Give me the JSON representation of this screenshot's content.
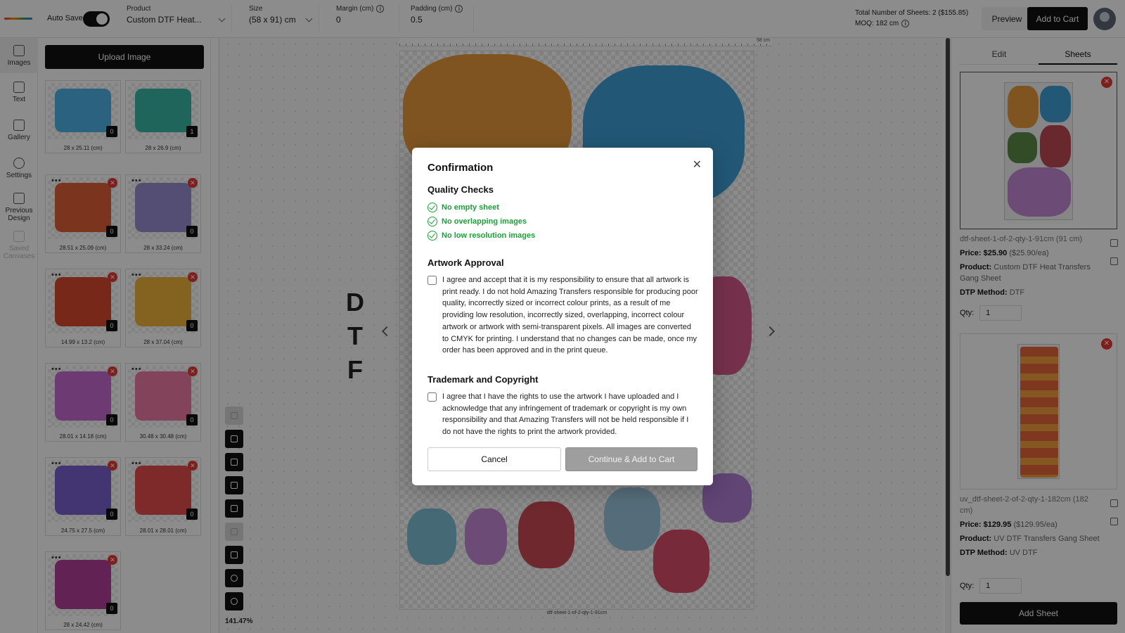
{
  "topbar": {
    "autosave_label": "Auto Save",
    "product_label": "Product",
    "product_value": "Custom DTF Heat...",
    "size_label": "Size",
    "size_value": "(58 x 91) cm",
    "margin_label": "Margin (cm)",
    "margin_value": "0",
    "padding_label": "Padding (cm)",
    "padding_value": "0.5",
    "total_sheets": "Total Number of Sheets: 2 ($155.85)",
    "moq": "MOQ: 182 cm",
    "preview_label": "Preview",
    "add_to_cart_label": "Add to Cart"
  },
  "rail": {
    "items": [
      {
        "label": "Images"
      },
      {
        "label": "Text"
      },
      {
        "label": "Gallery"
      },
      {
        "label": "Settings"
      },
      {
        "label": "Previous Design"
      },
      {
        "label": "Saved Canvases"
      }
    ]
  },
  "panel": {
    "upload_label": "Upload Image",
    "thumbs": [
      {
        "size": "28 x 25.11 (cm)",
        "count": "0",
        "color": "#4fb3e8"
      },
      {
        "size": "28 x 26.9 (cm)",
        "count": "1",
        "color": "#39b8a8"
      },
      {
        "size": "28.51 x 25.09 (cm)",
        "count": "0",
        "color": "#e0623a"
      },
      {
        "size": "28 x 33.24 (cm)",
        "count": "0",
        "color": "#9a8fd6"
      },
      {
        "size": "14.99 x 13.2 (cm)",
        "count": "0",
        "color": "#d9492f"
      },
      {
        "size": "28 x 37.04 (cm)",
        "count": "0",
        "color": "#f1b23b"
      },
      {
        "size": "28.01 x 14.18 (cm)",
        "count": "0",
        "color": "#c86bd3"
      },
      {
        "size": "30.48 x 30.48 (cm)",
        "count": "0",
        "color": "#ef7aa6"
      },
      {
        "size": "24.75 x 27.5 (cm)",
        "count": "0",
        "color": "#7b5fd0"
      },
      {
        "size": "28.01 x 28.01 (cm)",
        "count": "0",
        "color": "#e64d4d"
      },
      {
        "size": "28 x 24.42 (cm)",
        "count": "0",
        "color": "#b23f9a"
      }
    ]
  },
  "canvas": {
    "ruler_end": "58 cm",
    "dtf_letters": [
      "D",
      "T",
      "F"
    ],
    "sheet_caption": "dtf-sheet-1-of-2-qty-1-91cm",
    "zoom": "141.47%"
  },
  "right_panel": {
    "tab_edit": "Edit",
    "tab_sheets": "Sheets",
    "sheets": [
      {
        "name": "dtf-sheet-1-of-2-qty-1-91cm (91 cm)",
        "price_label": "Price:",
        "price": "$25.90",
        "price_each": "($25.90/ea)",
        "product_label": "Product:",
        "product": "Custom DTF Heat Transfers Gang Sheet",
        "method_label": "DTP Method:",
        "method": "DTF",
        "qty_label": "Qty:",
        "qty": "1"
      },
      {
        "name": "uv_dtf-sheet-2-of-2-qty-1-182cm (182 cm)",
        "price_label": "Price:",
        "price": "$129.95",
        "price_each": "($129.95/ea)",
        "product_label": "Product:",
        "product": "UV DTF Transfers Gang Sheet",
        "method_label": "DTP Method:",
        "method": "UV DTF",
        "qty_label": "Qty:",
        "qty": "1"
      }
    ],
    "add_sheet_label": "Add Sheet"
  },
  "modal": {
    "title": "Confirmation",
    "quality_title": "Quality Checks",
    "checks": [
      "No empty sheet",
      "No overlapping images",
      "No low resolution images"
    ],
    "artwork_title": "Artwork Approval",
    "artwork_text": "I agree and accept that it is my responsibility to ensure that all artwork is print ready. I do not hold Amazing Transfers responsible for producing poor quality, incorrectly sized or incorrect colour prints, as a result of me providing low resolution, incorrectly sized, overlapping, incorrect colour artwork or artwork with semi-transparent pixels. All images are converted to CMYK for printing. I understand that no changes can be made, once my order has been approved and in the print queue.",
    "trademark_title": "Trademark and Copyright",
    "trademark_text": "I agree that I have the rights to use the artwork I have uploaded and I acknowledge that any infringement of trademark or copyright is my own responsibility and that Amazing Transfers will not be held responsible if I do not have the rights to print the artwork provided.",
    "cancel_label": "Cancel",
    "continue_label": "Continue & Add to Cart",
    "accent_green": "#1f9d3b"
  }
}
